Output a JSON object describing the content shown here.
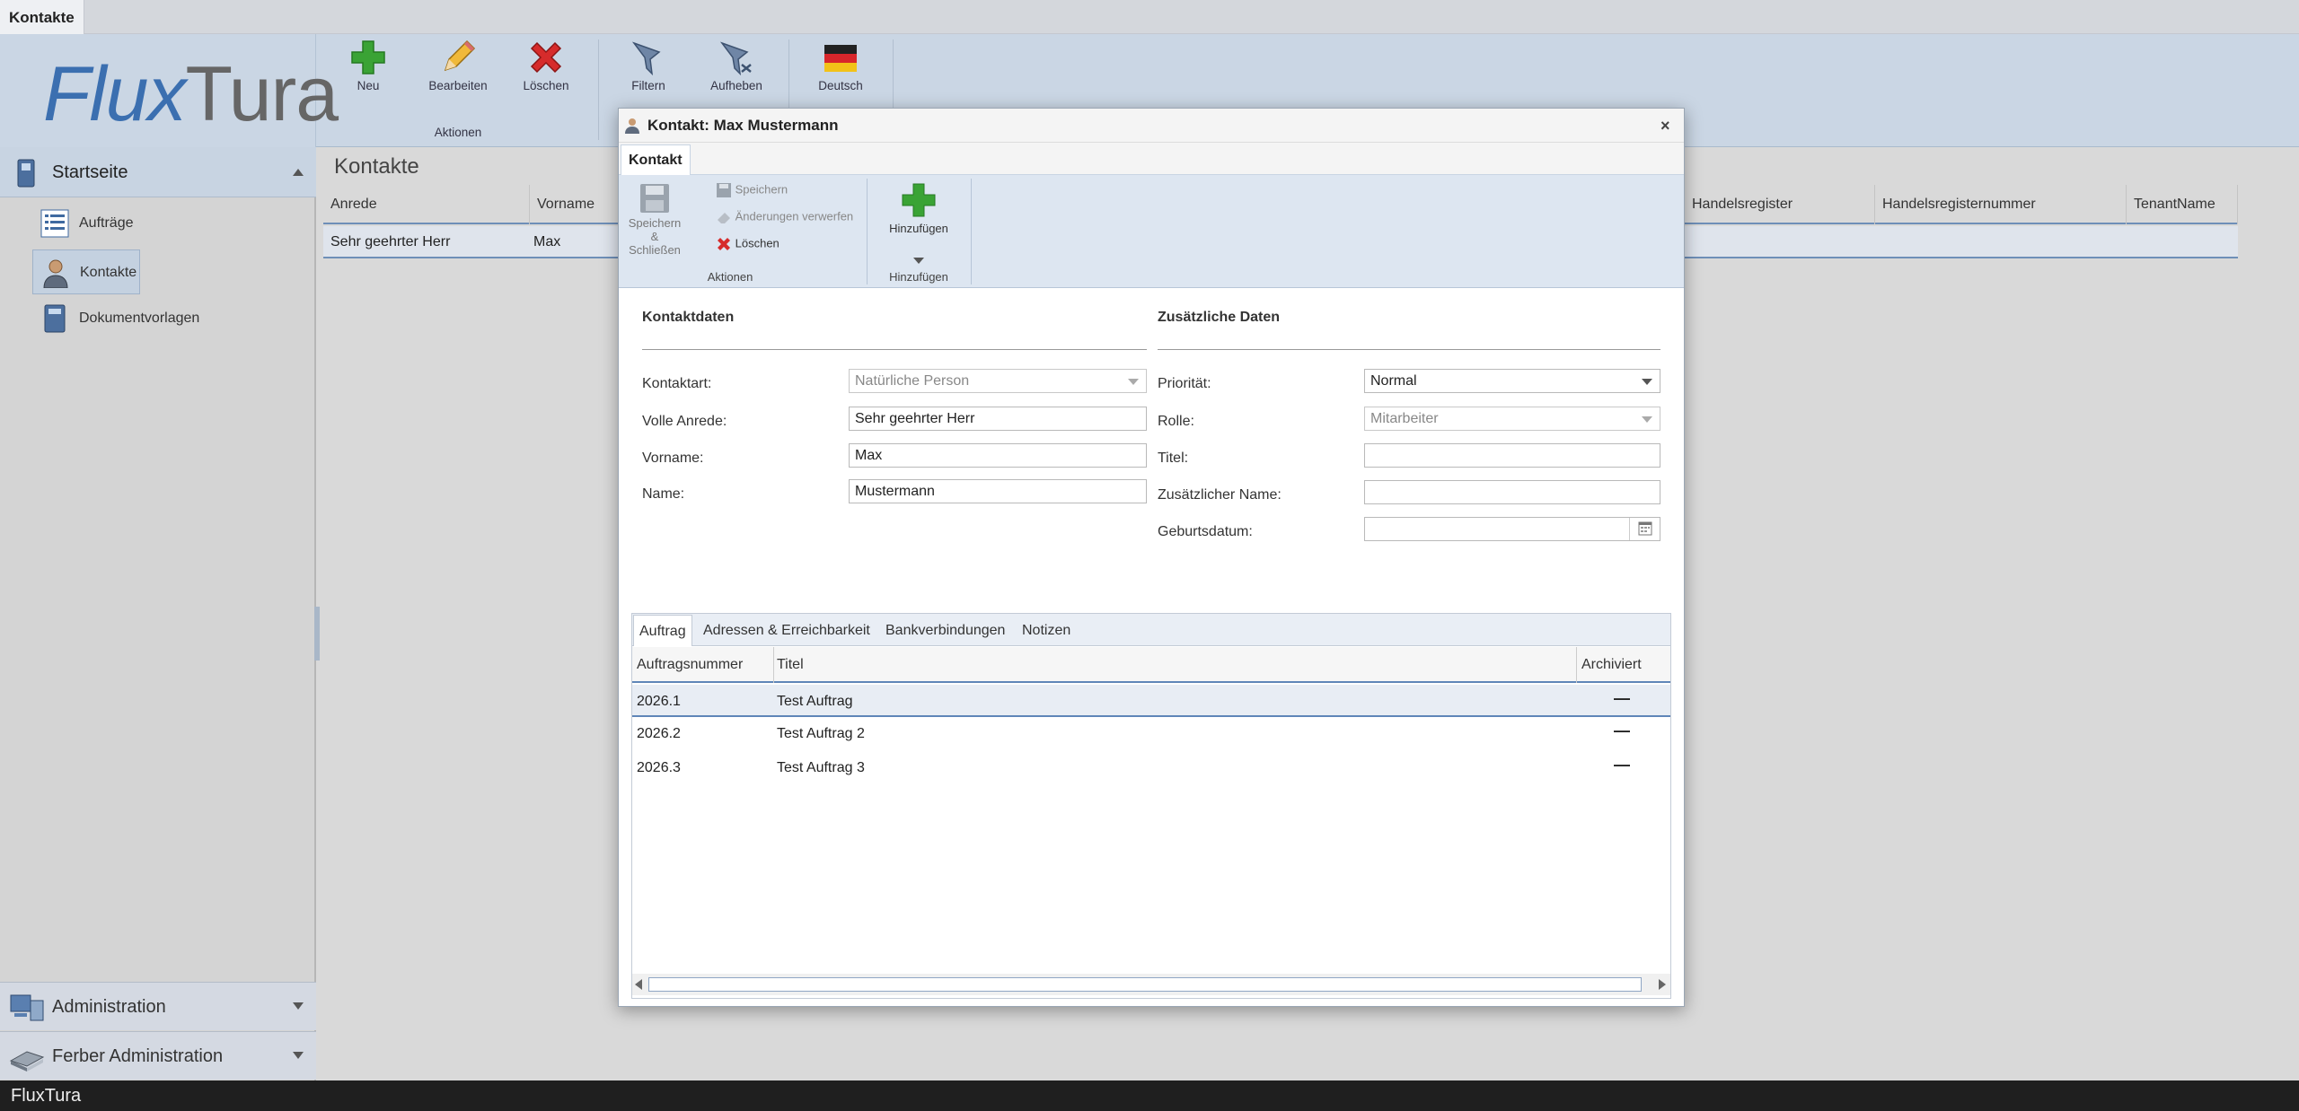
{
  "window": {
    "tab": "Kontakte",
    "status": "FluxTura"
  },
  "logo": {
    "text_flux": "Flux",
    "text_tura": "Tura"
  },
  "ribbon": {
    "new": "Neu",
    "edit": "Bearbeiten",
    "delete": "Löschen",
    "group_actions": "Aktionen",
    "filter": "Filtern",
    "clear_filter": "Aufheben",
    "language": "Deutsch"
  },
  "sidebar": {
    "header": "Startseite",
    "items": [
      {
        "label": "Aufträge",
        "icon": "list-icon"
      },
      {
        "label": "Kontakte",
        "icon": "person-icon"
      },
      {
        "label": "Dokumentvorlagen",
        "icon": "document-icon"
      }
    ],
    "footer": [
      {
        "label": "Administration",
        "icon": "admin-icon"
      },
      {
        "label": "Ferber Administration",
        "icon": "book-icon"
      }
    ]
  },
  "main": {
    "title": "Kontakte",
    "columns_left": [
      "Anrede",
      "Vorname"
    ],
    "columns_right": [
      "Handelsregister",
      "Handelsregisternummer",
      "TenantName"
    ],
    "row": {
      "anrede": "Sehr geehrter Herr",
      "vorname": "Max"
    }
  },
  "dialog": {
    "title": "Kontakt: Max Mustermann",
    "ribbon_tab": "Kontakt",
    "save_close": "Speichern & Schließen",
    "save": "Speichern",
    "discard": "Änderungen verwerfen",
    "delete": "Löschen",
    "group_actions": "Aktionen",
    "add": "Hinzufügen",
    "group_add": "Hinzufügen",
    "section_contact": "Kontaktdaten",
    "section_extra": "Zusätzliche Daten",
    "fields_left": [
      {
        "label": "Kontaktart:",
        "value": "Natürliche Person"
      },
      {
        "label": "Volle Anrede:",
        "value": "Sehr geehrter Herr"
      },
      {
        "label": "Vorname:",
        "value": "Max"
      },
      {
        "label": "Name:",
        "value": "Mustermann"
      }
    ],
    "fields_right": [
      {
        "label": "Priorität:",
        "value": "Normal"
      },
      {
        "label": "Rolle:",
        "value": "Mitarbeiter"
      },
      {
        "label": "Titel:",
        "value": ""
      },
      {
        "label": "Zusätzlicher Name:",
        "value": ""
      },
      {
        "label": "Geburtsdatum:",
        "value": ""
      }
    ],
    "tabs": [
      "Auftrag",
      "Adressen & Erreichbarkeit",
      "Bankverbindungen",
      "Notizen"
    ],
    "grid_columns": [
      "Auftragsnummer",
      "Titel",
      "Archiviert"
    ],
    "orders": [
      {
        "nummer": "2026.1",
        "titel": "Test Auftrag",
        "archiviert": "—"
      },
      {
        "nummer": "2026.2",
        "titel": "Test Auftrag 2",
        "archiviert": "—"
      },
      {
        "nummer": "2026.3",
        "titel": "Test Auftrag 3",
        "archiviert": "—"
      }
    ]
  }
}
